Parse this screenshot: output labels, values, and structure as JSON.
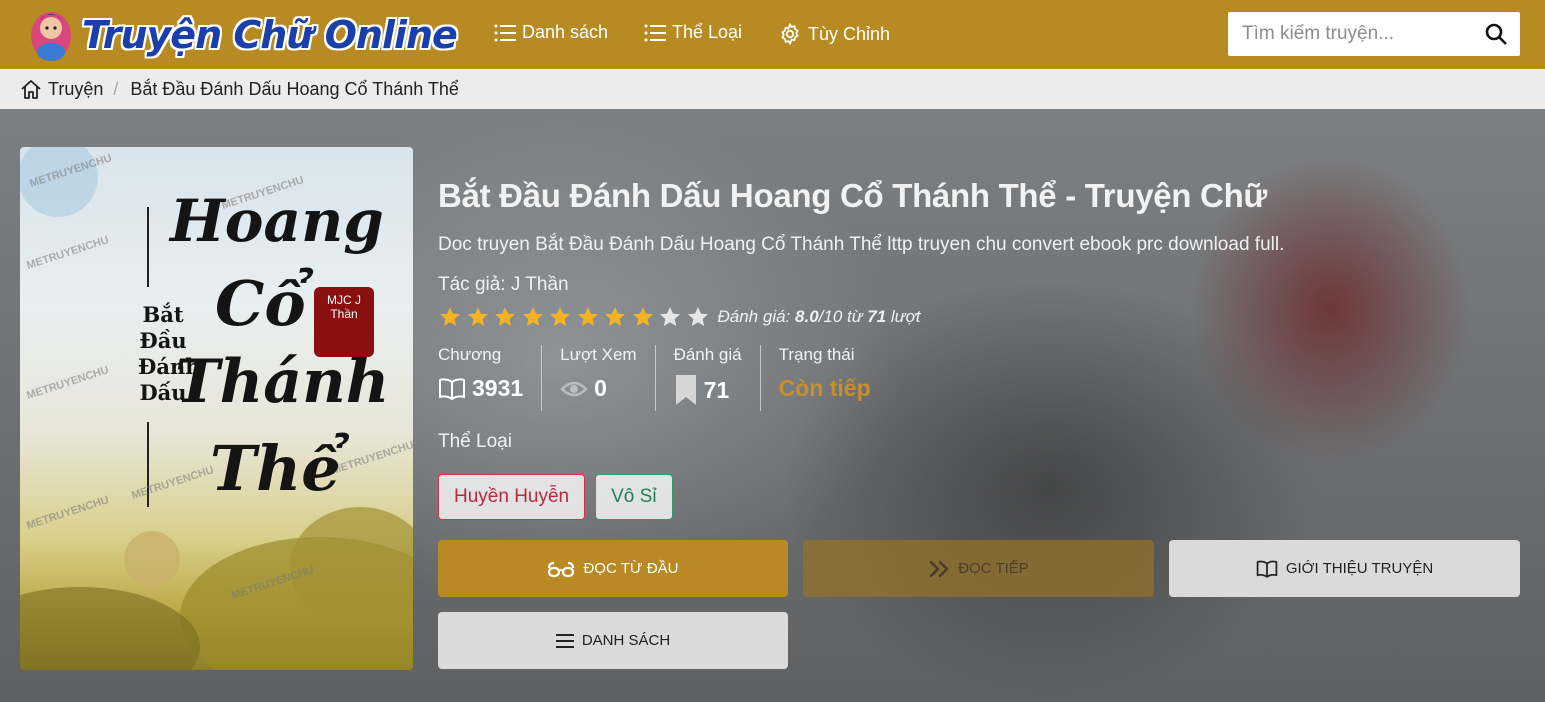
{
  "header": {
    "logo_text": "Truyện Chữ Online",
    "nav": [
      {
        "label": "Danh sách",
        "icon": "list-icon"
      },
      {
        "label": "Thể Loại",
        "icon": "list-icon"
      },
      {
        "label": "Tùy Chỉnh",
        "icon": "gear-icon"
      }
    ],
    "search": {
      "placeholder": "Tìm kiếm truyện...",
      "value": ""
    }
  },
  "breadcrumb": {
    "home": "Truyện",
    "current": "Bắt Đầu Đánh Dấu Hoang Cổ Thánh Thể"
  },
  "cover": {
    "art_title_lines": [
      "Hoang",
      "Cổ",
      "Thánh",
      "Thể"
    ],
    "side_title": "Bắt Đầu Đánh Dấu",
    "seal": "MJC J Thần",
    "watermark": "METRUYENCHU"
  },
  "book": {
    "title": "Bắt Đầu Đánh Dấu Hoang Cổ Thánh Thể - Truyện Chữ",
    "description": "Doc truyen Bắt Đầu Đánh Dấu Hoang Cổ Thánh Thể lttp truyen chu convert ebook prc download full.",
    "author_label": "Tác giả:",
    "author": "J Thần",
    "rating": {
      "prefix": "Đánh giá:",
      "score": "8.0",
      "out_of": "/10 từ",
      "count": "71",
      "suffix": "lượt",
      "stars_total": 10,
      "stars_filled": 8
    },
    "stats": {
      "chapters_label": "Chương",
      "chapters": "3931",
      "views_label": "Lượt Xem",
      "views": "0",
      "ratings_label": "Đánh giá",
      "ratings": "71",
      "status_label": "Trạng thái",
      "status": "Còn tiếp"
    },
    "genre_heading": "Thể Loại",
    "genres": [
      "Huyền Huyễn",
      "Vô Sỉ"
    ]
  },
  "buttons": {
    "read_start": "Đọc từ đầu",
    "read_continue": "Đọc tiếp",
    "intro": "Giới thiệu truyện",
    "chapter_list": "Danh sách"
  },
  "colors": {
    "header_bg": "#b88b22",
    "accent": "#b98a23",
    "status": "#c8902a",
    "star": "#f3b324"
  }
}
